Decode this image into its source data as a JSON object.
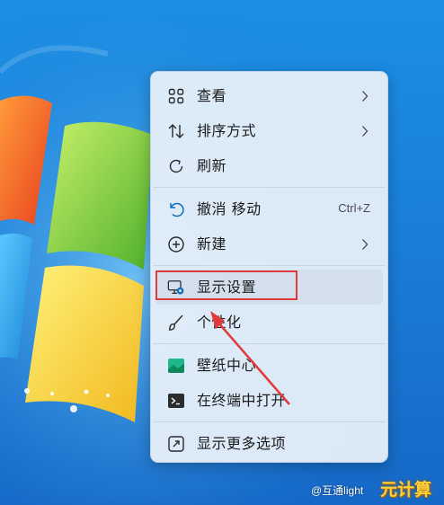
{
  "menu": {
    "items": [
      {
        "label": "查看",
        "icon": "grid-icon",
        "has_submenu": true
      },
      {
        "label": "排序方式",
        "icon": "sort-icon",
        "has_submenu": true
      },
      {
        "label": "刷新",
        "icon": "refresh-icon",
        "has_submenu": false
      },
      {
        "label": "撤消 移动",
        "icon": "undo-icon",
        "shortcut": "Ctrl+Z"
      },
      {
        "label": "新建",
        "icon": "plus-circle-icon",
        "has_submenu": true
      },
      {
        "label": "显示设置",
        "icon": "display-settings-icon",
        "highlighted": true
      },
      {
        "label": "个性化",
        "icon": "brush-icon"
      },
      {
        "label": "壁纸中心",
        "icon": "wallpaper-icon"
      },
      {
        "label": "在终端中打开",
        "icon": "terminal-icon"
      },
      {
        "label": "显示更多选项",
        "icon": "expand-icon"
      }
    ]
  },
  "annotation": {
    "highlight_color": "#e03a3a"
  },
  "watermark": {
    "text": "@互通light",
    "logo": "元计算"
  },
  "colors": {
    "menu_bg": "#e4eef9",
    "accent": "#0f6cbd",
    "desktop": "#1a7fd8"
  }
}
